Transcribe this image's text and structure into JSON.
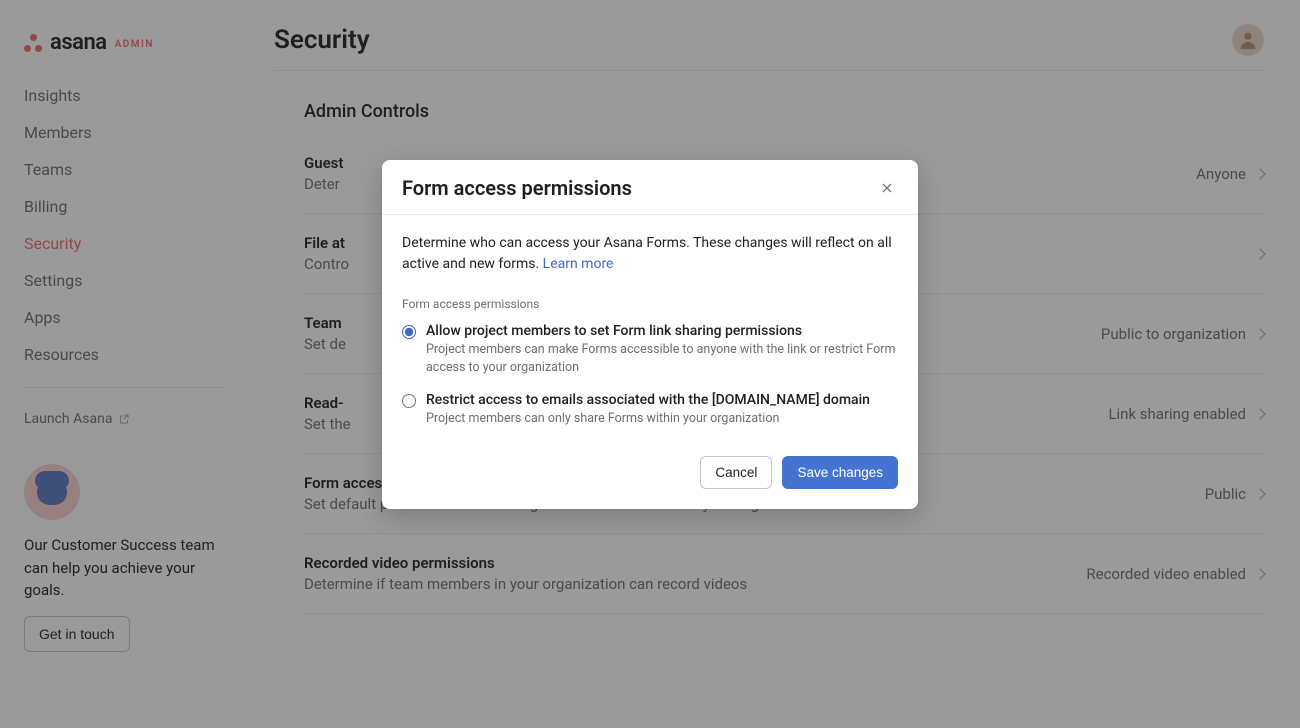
{
  "brand": {
    "name": "asana",
    "tag": "ADMIN"
  },
  "sidebar": {
    "items": [
      {
        "label": "Insights"
      },
      {
        "label": "Members"
      },
      {
        "label": "Teams"
      },
      {
        "label": "Billing"
      },
      {
        "label": "Security"
      },
      {
        "label": "Settings"
      },
      {
        "label": "Apps"
      },
      {
        "label": "Resources"
      }
    ],
    "active_index": 4,
    "launch_label": "Launch Asana",
    "cs_text": "Our Customer Success team can help you achieve your goals.",
    "cs_button": "Get in touch"
  },
  "header": {
    "title": "Security"
  },
  "section": {
    "heading": "Admin Controls",
    "rows": [
      {
        "title": "Guest",
        "desc": "Deter",
        "value": "Anyone"
      },
      {
        "title": "File at",
        "desc": "Contro",
        "value": ""
      },
      {
        "title": "Team",
        "desc": "Set de",
        "value": "Public to organization"
      },
      {
        "title": "Read-",
        "desc": "Set the",
        "value": "Link sharing enabled"
      },
      {
        "title": "Form access permissions",
        "desc": "Set default permission on accesing Forms within or outside your Organization",
        "value": "Public"
      },
      {
        "title": "Recorded video permissions",
        "desc": "Determine if team members in your organization can record videos",
        "value": "Recorded video enabled"
      }
    ]
  },
  "modal": {
    "title": "Form access permissions",
    "description": "Determine who can access your Asana Forms. These changes will reflect on all active and new forms. ",
    "learn_more": "Learn more",
    "field_label": "Form access permissions",
    "option1": {
      "title": "Allow project members to set Form link sharing permissions",
      "desc": "Project members can make Forms accessible to anyone with the link or restrict Form access to your organization"
    },
    "option2": {
      "title": "Restrict access to emails associated with the [DOMAIN_NAME] domain",
      "desc": "Project members can only share Forms within your organization"
    },
    "cancel": "Cancel",
    "save": "Save changes"
  }
}
